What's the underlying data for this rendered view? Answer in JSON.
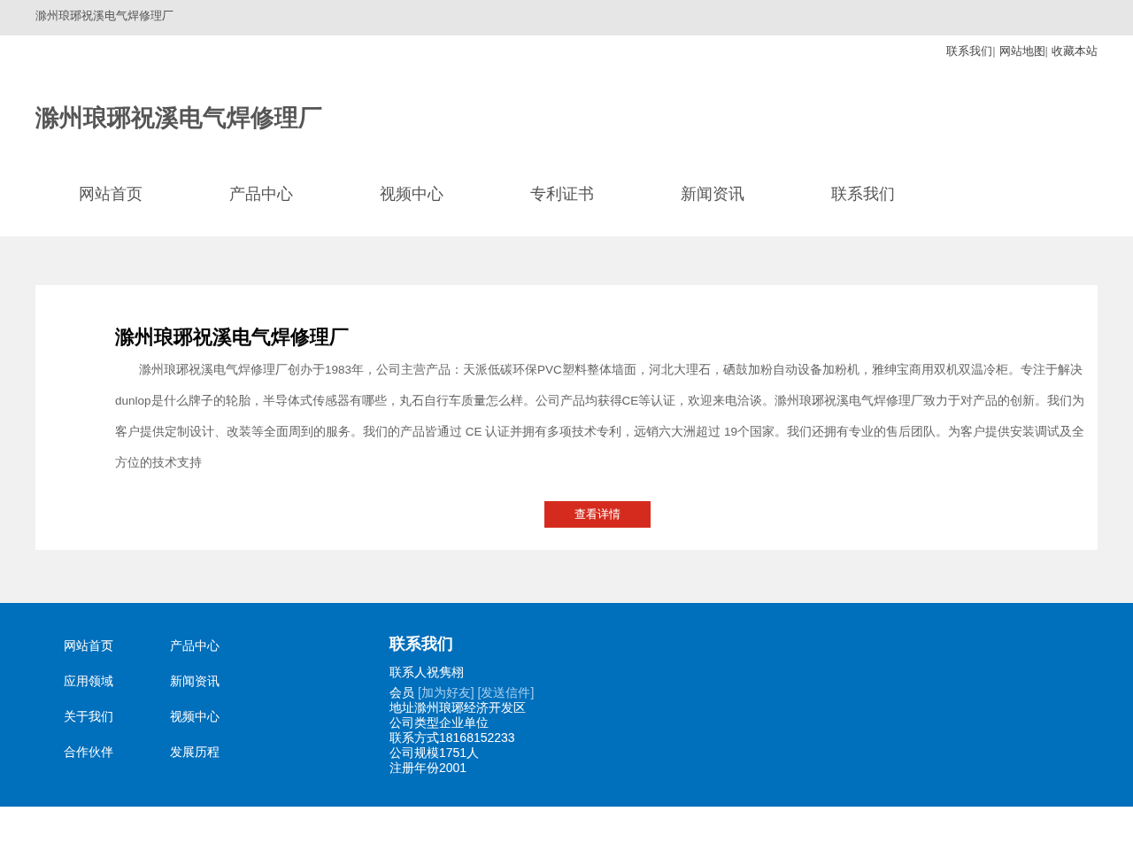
{
  "top_bar": {
    "title": "滁州琅琊祝溪电气焊修理厂"
  },
  "header": {
    "links": [
      "联系我们",
      "网站地图",
      "收藏本站"
    ],
    "separator": "|",
    "logo": "滁州琅琊祝溪电气焊修理厂"
  },
  "nav": [
    {
      "label": "网站首页"
    },
    {
      "label": "产品中心"
    },
    {
      "label": "视频中心"
    },
    {
      "label": "专利证书"
    },
    {
      "label": "新闻资讯"
    },
    {
      "label": "联系我们"
    }
  ],
  "intro": {
    "title": "滁州琅琊祝溪电气焊修理厂",
    "text": "滁州琅琊祝溪电气焊修理厂创办于1983年，公司主营产品：天派低碳环保PVC塑料整体墙面，河北大理石，硒鼓加粉自动设备加粉机，雅绅宝商用双机双温冷柜。专注于解决dunlop是什么牌子的轮胎，半导体式传感器有哪些，丸石自行车质量怎么样。公司产品均获得CE等认证，欢迎来电洽谈。滁州琅琊祝溪电气焊修理厂致力于对产品的创新。我们为客户提供定制设计、改装等全面周到的服务。我们的产品皆通过 CE 认证并拥有多项技术专利，远销六大洲超过 19个国家。我们还拥有专业的售后团队。为客户提供安装调试及全方位的技术支持",
    "button": "查看详情"
  },
  "footer": {
    "links": [
      "网站首页",
      "产品中心",
      "应用领域",
      "新闻资讯",
      "关于我们",
      "视频中心",
      "合作伙伴",
      "发展历程"
    ],
    "contact": {
      "title": "联系我们",
      "person": "联系人祝隽栩",
      "member_label": "会员",
      "member_links": [
        "[加为好友]",
        "[发送信件]"
      ],
      "lines": [
        "地址滁州琅琊经济开发区",
        "公司类型企业单位",
        "联系方式18168152233",
        "公司规模1751人",
        "注册年份2001"
      ]
    }
  }
}
